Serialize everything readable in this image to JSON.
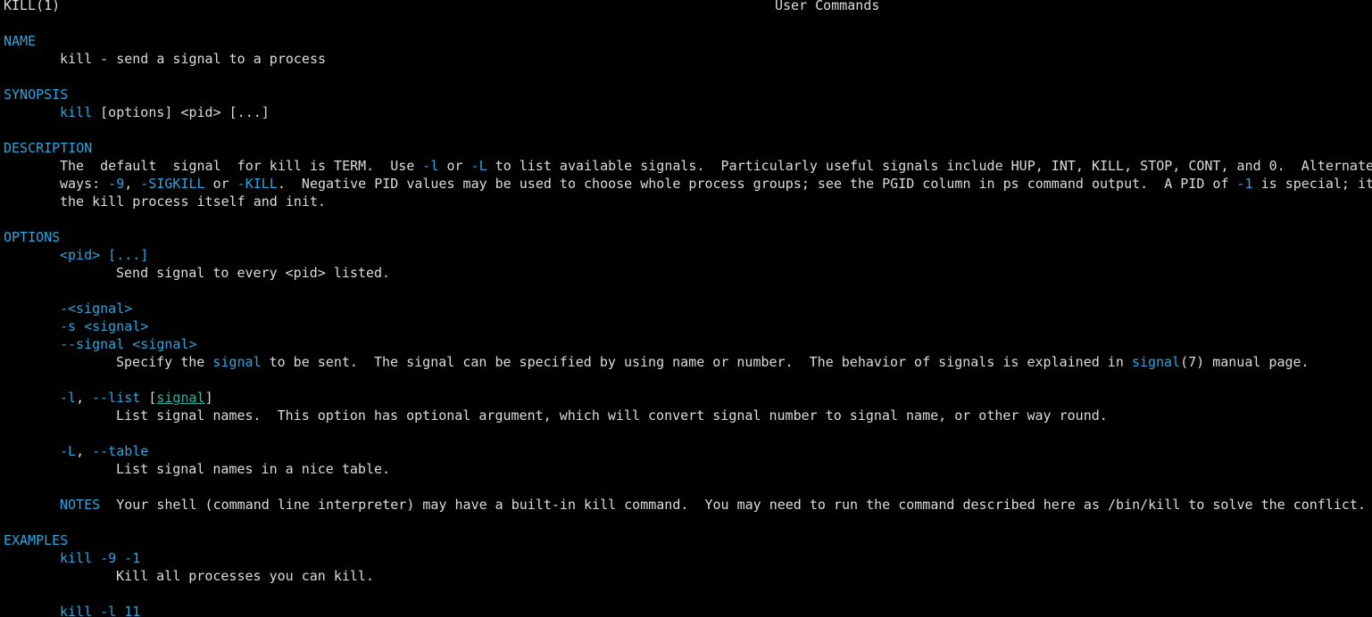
{
  "header": {
    "left": "KILL(1)",
    "center": "User Commands"
  },
  "name": {
    "heading": "NAME",
    "text": "kill - send a signal to a process"
  },
  "synopsis": {
    "heading": "SYNOPSIS",
    "command": "kill",
    "args": " [options] <pid> [...]"
  },
  "description": {
    "heading": "DESCRIPTION",
    "l1_a": "The  default  signal  for kill is TERM.  Use ",
    "opt_l": "-l",
    "l1_or": " or ",
    "opt_L": "-L",
    "l1_b": " to list available signals.  Particularly useful signals include HUP, INT, KILL, STOP, CONT, and 0.  Alternate",
    "l2_a": "ways: ",
    "opt_9": "-9",
    "l2_comma": ", ",
    "opt_sigkill": "-SIGKILL",
    "l2_or": " or ",
    "opt_kill": "-KILL",
    "l2_b": ".  Negative PID values may be used to choose whole process groups; see the PGID column in ps command output.  A PID of ",
    "opt_m1": "-1",
    "l2_c": " is special; it",
    "l3": "the kill process itself and init."
  },
  "options": {
    "heading": "OPTIONS",
    "pid_term": "<pid> [...]",
    "pid_desc": "Send signal to every <pid> listed.",
    "sig_term1": "-<signal>",
    "sig_term2": "-s <signal>",
    "sig_term3": "--signal <signal>",
    "sig_desc_a": "Specify the ",
    "sig_desc_link": "signal",
    "sig_desc_b": " to be sent.  The signal can be specified by using name or number.  The behavior of signals is explained in ",
    "sig_desc_ref": "signal",
    "sig_desc_c": "(7) manual page.",
    "list_opt_short": "-l",
    "list_comma": ", ",
    "list_opt_long": "--list",
    "list_bracket_open": " [",
    "list_arg": "signal",
    "list_bracket_close": "]",
    "list_desc": "List signal names.  This option has optional argument, which will convert signal number to signal name, or other way round.",
    "table_opt_short": "-L",
    "table_comma": ", ",
    "table_opt_long": "--table",
    "table_desc": "List signal names in a nice table.",
    "notes_label": "NOTES",
    "notes_text": "  Your shell (command line interpreter) may have a built-in kill command.  You may need to run the command described here as /bin/kill to solve the conflict."
  },
  "examples": {
    "heading": "EXAMPLES",
    "ex1_cmd": "kill -9 -1",
    "ex1_desc": "Kill all processes you can kill.",
    "ex2_cmd": "kill -l 11"
  },
  "colors": {
    "background": "#000000",
    "text": "#dcdcdc",
    "highlight": "#2aa6e0",
    "underline": "#2bb3a3"
  }
}
